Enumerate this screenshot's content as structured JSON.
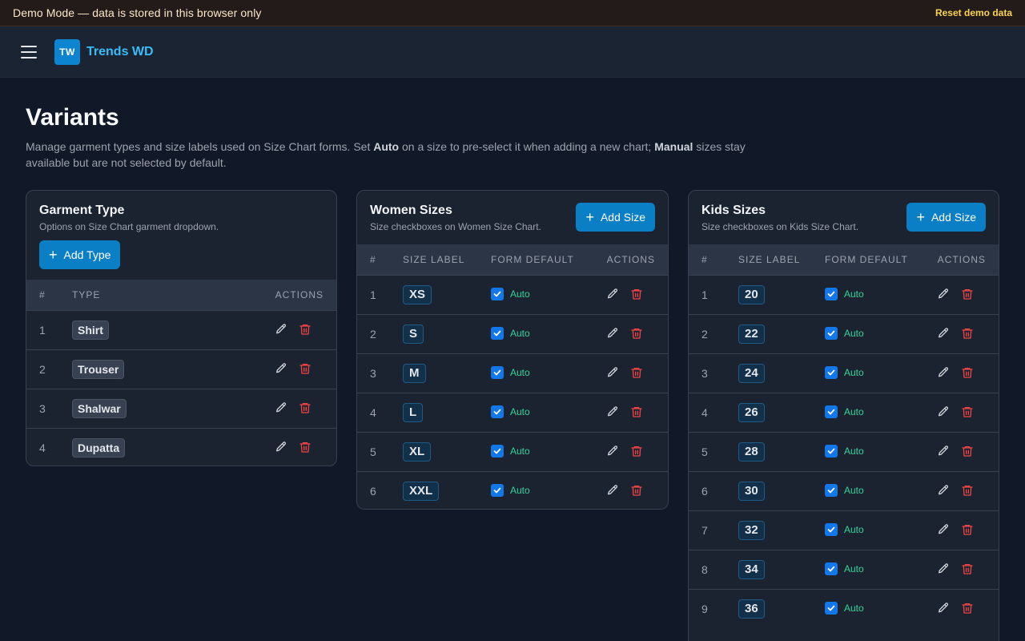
{
  "demo_bar": {
    "text": "Demo Mode — data is stored in this browser only",
    "reset_label": "Reset demo data"
  },
  "nav": {
    "logo_text": "TW",
    "brand_name": "Trends WD",
    "menu_icon": "hamburger-menu-icon"
  },
  "page": {
    "title": "Variants",
    "desc_1": "Manage garment types and size labels used on Size Chart forms. Set ",
    "desc_auto": "Auto",
    "desc_2": " on a size to pre-select it when adding a new chart; ",
    "desc_manual": "Manual",
    "desc_3": " sizes stay available but are not selected by default."
  },
  "garment": {
    "title": "Garment Type",
    "subtitle": "Options on Size Chart garment dropdown.",
    "add_label": "Add Type",
    "headers": {
      "num": "#",
      "type": "TYPE",
      "actions": "ACTIONS"
    },
    "rows": [
      {
        "num": "1",
        "type": "Shirt"
      },
      {
        "num": "2",
        "type": "Trouser"
      },
      {
        "num": "3",
        "type": "Shalwar"
      },
      {
        "num": "4",
        "type": "Dupatta"
      }
    ]
  },
  "women": {
    "title": "Women Sizes",
    "subtitle": "Size checkboxes on Women Size Chart.",
    "add_label": "Add Size",
    "headers": {
      "num": "#",
      "label": "SIZE LABEL",
      "default": "FORM DEFAULT",
      "actions": "ACTIONS"
    },
    "rows": [
      {
        "num": "1",
        "label": "XS",
        "default": "Auto",
        "checked": true
      },
      {
        "num": "2",
        "label": "S",
        "default": "Auto",
        "checked": true
      },
      {
        "num": "3",
        "label": "M",
        "default": "Auto",
        "checked": true
      },
      {
        "num": "4",
        "label": "L",
        "default": "Auto",
        "checked": true
      },
      {
        "num": "5",
        "label": "XL",
        "default": "Auto",
        "checked": true
      },
      {
        "num": "6",
        "label": "XXL",
        "default": "Auto",
        "checked": true
      }
    ]
  },
  "kids": {
    "title": "Kids Sizes",
    "subtitle": "Size checkboxes on Kids Size Chart.",
    "add_label": "Add Size",
    "headers": {
      "num": "#",
      "label": "SIZE LABEL",
      "default": "FORM DEFAULT",
      "actions": "ACTIONS"
    },
    "rows": [
      {
        "num": "1",
        "label": "20",
        "default": "Auto",
        "checked": true
      },
      {
        "num": "2",
        "label": "22",
        "default": "Auto",
        "checked": true
      },
      {
        "num": "3",
        "label": "24",
        "default": "Auto",
        "checked": true
      },
      {
        "num": "4",
        "label": "26",
        "default": "Auto",
        "checked": true
      },
      {
        "num": "5",
        "label": "28",
        "default": "Auto",
        "checked": true
      },
      {
        "num": "6",
        "label": "30",
        "default": "Auto",
        "checked": true
      },
      {
        "num": "7",
        "label": "32",
        "default": "Auto",
        "checked": true
      },
      {
        "num": "8",
        "label": "34",
        "default": "Auto",
        "checked": true
      },
      {
        "num": "9",
        "label": "36",
        "default": "Auto",
        "checked": true
      }
    ]
  },
  "colors": {
    "accent": "#0b7fc6",
    "brand_text": "#38bdf8",
    "auto_text": "#34d399",
    "delete_icon": "#ef4444"
  },
  "icons": {
    "edit": "pencil-icon",
    "delete": "trash-icon",
    "add": "plus-icon",
    "checkbox": "checkmark-icon"
  }
}
